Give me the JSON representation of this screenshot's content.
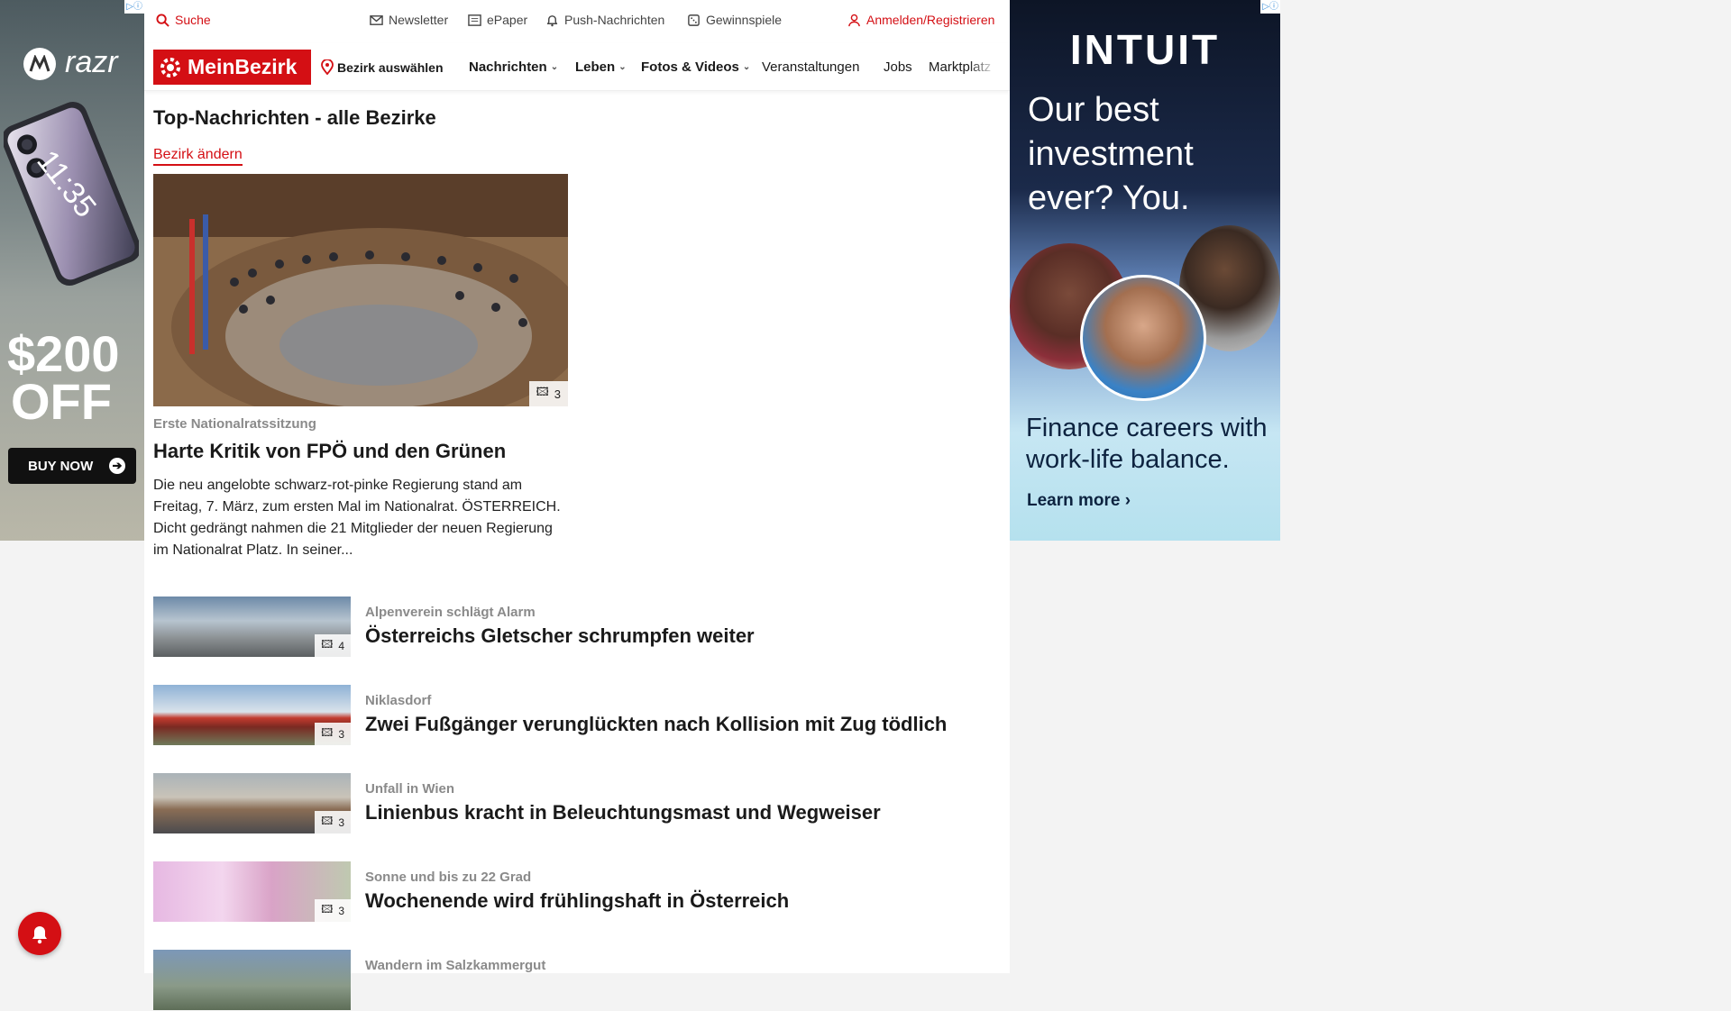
{
  "topbar": {
    "search_label": "Suche",
    "newsletter_label": "Newsletter",
    "epaper_label": "ePaper",
    "push_label": "Push-Nachrichten",
    "gewinnspiele_label": "Gewinnspiele",
    "login_label": "Anmelden/Registrieren"
  },
  "navbar": {
    "logo_text": "MeinBezirk",
    "district_label": "Bezirk auswählen",
    "items": [
      "Nachrichten",
      "Leben",
      "Fotos & Videos",
      "Veranstaltungen",
      "Jobs",
      "Marktplatz"
    ]
  },
  "main": {
    "page_title": "Top-Nachrichten - alle Bezirke",
    "change_district_label": "Bezirk ändern",
    "hero": {
      "image_count": "3",
      "kicker": "Erste Nationalratssitzung",
      "title": "Harte Kritik von FPÖ und den Grünen",
      "teaser": "Die neu angelobte schwarz-rot-pinke Regierung stand am Freitag, 7. März, zum ersten Mal im Nationalrat. ÖSTERREICH. Dicht gedrängt nahmen die 21 Mitglieder der neuen Regierung im Nationalrat Platz. In seiner..."
    },
    "articles": [
      {
        "kicker": "Alpenverein schlägt Alarm",
        "title": "Österreichs Gletscher schrumpfen weiter",
        "image_count": "4"
      },
      {
        "kicker": "Niklasdorf",
        "title": "Zwei Fußgänger verunglückten nach Kollision mit Zug tödlich",
        "image_count": "3"
      },
      {
        "kicker": "Unfall in Wien",
        "title": "Linienbus kracht in Beleuchtungsmast und Wegweiser",
        "image_count": "3"
      },
      {
        "kicker": "Sonne und bis zu 22 Grad",
        "title": "Wochenende wird frühlingshaft in Österreich",
        "image_count": "3"
      },
      {
        "kicker": "Wandern im Salzkammergut",
        "title": "",
        "image_count": ""
      }
    ]
  },
  "ad_left": {
    "brand": "razr",
    "phone_time": "11:35",
    "offer_amount": "$200",
    "offer_word": "OFF",
    "cta": "BUY NOW"
  },
  "ad_right": {
    "brand": "INTUIT",
    "headline": "Our best investment ever? You.",
    "subline": "Finance careers with work-life balance.",
    "cta": "Learn more ›"
  },
  "adchoice_label": "▷ⓘ",
  "colors": {
    "brand_red": "#d40f14",
    "kicker_gray": "#8a8a8a"
  }
}
